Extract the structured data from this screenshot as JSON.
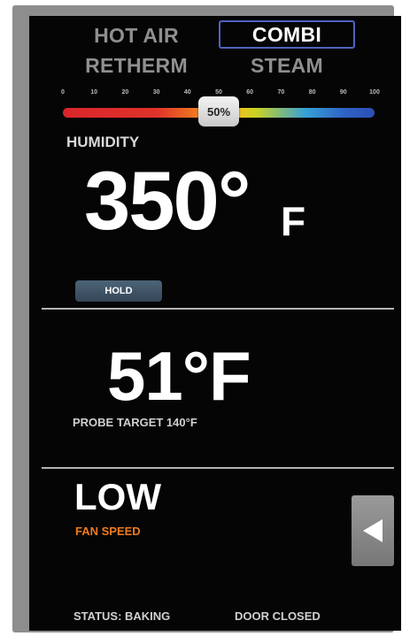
{
  "modes": {
    "hot_air": "HOT AIR",
    "combi": "COMBI",
    "retherm": "RETHERM",
    "steam": "STEAM",
    "active": "combi"
  },
  "humidity_slider": {
    "ticks": [
      "0",
      "10",
      "20",
      "30",
      "40",
      "50",
      "60",
      "70",
      "80",
      "90",
      "100"
    ],
    "value": 50,
    "value_label": "50%",
    "label": "HUMIDITY"
  },
  "oven": {
    "temperature_number": "350°",
    "temperature_unit": "F"
  },
  "hold_button": {
    "label": "HOLD"
  },
  "probe": {
    "temperature": "51°F",
    "target": "PROBE TARGET 140°F"
  },
  "fan": {
    "value": "LOW",
    "label": "FAN SPEED"
  },
  "back_button": {
    "icon": "arrow-left-icon"
  },
  "status_bar": {
    "status": "STATUS: BAKING",
    "door": "DOOR CLOSED"
  },
  "colors": {
    "screen_bg": "#050505",
    "active_mode_border": "#4e63bf",
    "fan_label": "#ee7b1d",
    "hold_button": "#3f5366"
  }
}
